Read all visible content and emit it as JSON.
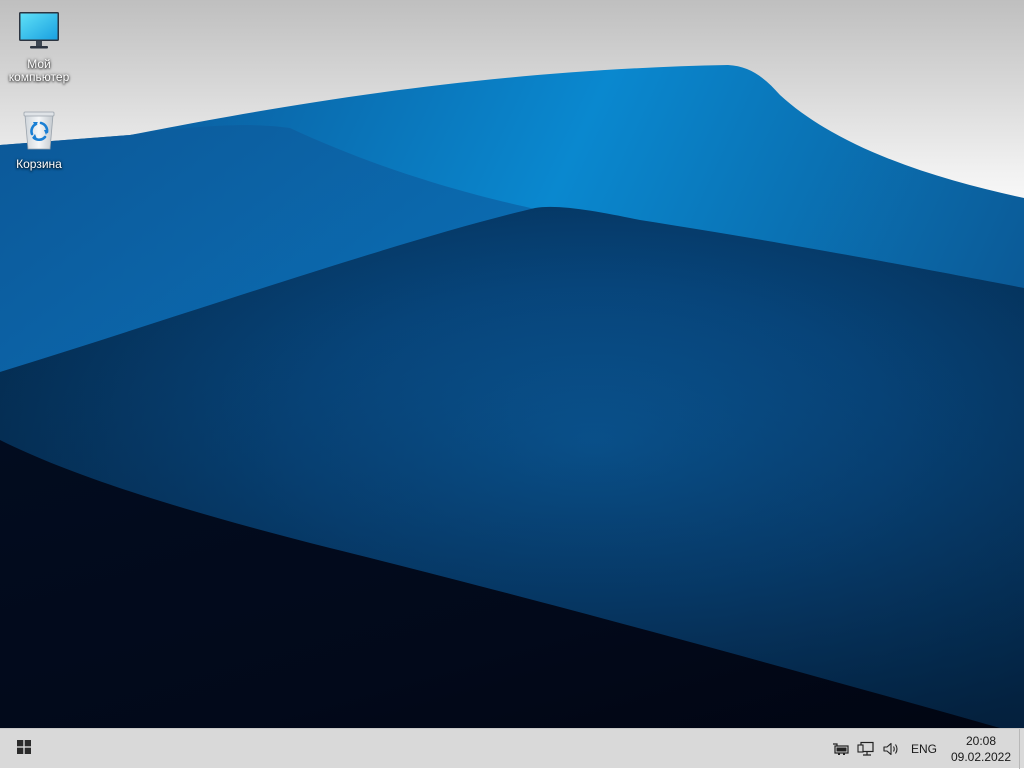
{
  "desktop": {
    "icons": [
      {
        "label": "Мой компьютер",
        "icon": "computer-icon"
      },
      {
        "label": "Корзина",
        "icon": "recycle-bin-icon"
      }
    ]
  },
  "taskbar": {
    "start_icon": "windows-logo-icon",
    "tray": {
      "icons": [
        "device-icon",
        "network-icon",
        "volume-icon"
      ],
      "language": "ENG",
      "time": "20:08",
      "date": "09.02.2022"
    }
  },
  "colors": {
    "wallpaper_dark": "#02091a",
    "wallpaper_mid": "#0a4c85",
    "wallpaper_light": "#0b86cf",
    "taskbar": "#d9d9d9"
  }
}
